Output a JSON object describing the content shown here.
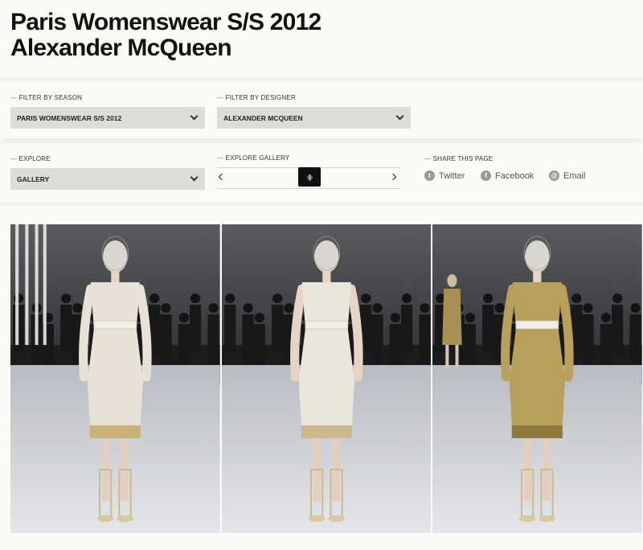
{
  "header": {
    "title_line1": "Paris Womenswear S/S 2012",
    "title_line2": "Alexander McQueen"
  },
  "filters": {
    "season_label": "FILTER BY SEASON",
    "season_value": "PARIS WOMENSWEAR S/S 2012",
    "designer_label": "FILTER BY DESIGNER",
    "designer_value": "ALEXANDER MCQUEEN"
  },
  "explore": {
    "label": "EXPLORE",
    "value": "GALLERY",
    "gallery_label": "EXPLORE GALLERY",
    "handle_glyph": "‹|||›"
  },
  "share": {
    "label": "SHARE THIS PAGE",
    "items": [
      {
        "label": "Twitter",
        "icon": "t"
      },
      {
        "label": "Facebook",
        "icon": "f"
      },
      {
        "label": "Email",
        "icon": "@"
      }
    ]
  },
  "gallery": {
    "looks": [
      {
        "name": "look-1",
        "dress_color": "#e8e2d6",
        "trim_color": "#c9b27a"
      },
      {
        "name": "look-2",
        "dress_color": "#ebe6dc",
        "trim_color": "#cbb88d"
      },
      {
        "name": "look-3",
        "dress_color": "#b8a05a",
        "trim_color": "#8f7a3e"
      }
    ]
  }
}
